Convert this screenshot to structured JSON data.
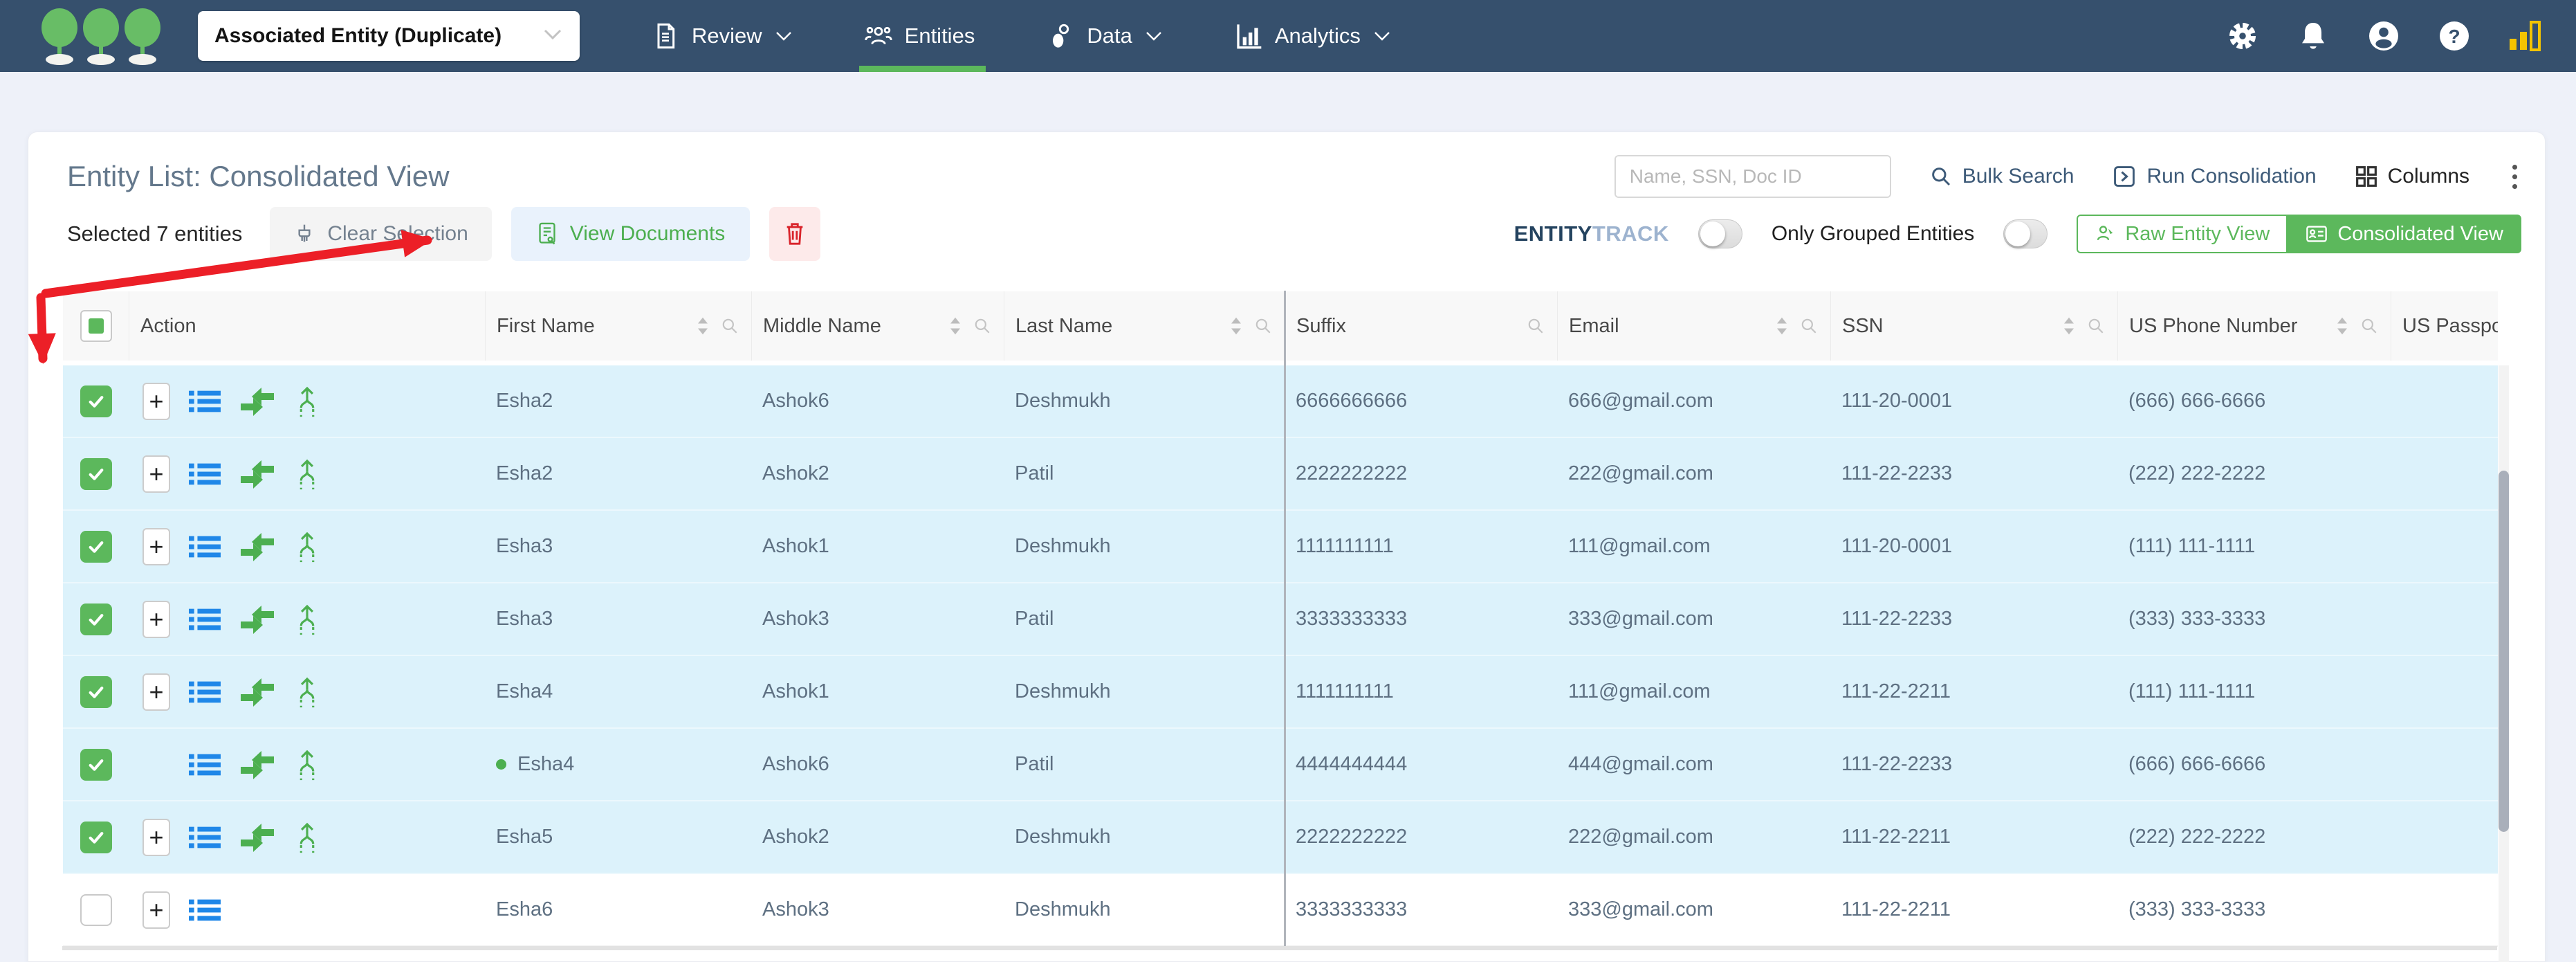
{
  "navbar": {
    "logo": "three-trees-logo",
    "workspace_dropdown": {
      "value": "Associated Entity (Duplicate)"
    },
    "items": [
      {
        "label": "Review",
        "icon": "document-icon",
        "caret": true,
        "active": false
      },
      {
        "label": "Entities",
        "icon": "people-icon",
        "caret": false,
        "active": true
      },
      {
        "label": "Data",
        "icon": "data-icon",
        "caret": true,
        "active": false
      },
      {
        "label": "Analytics",
        "icon": "bar-chart-icon",
        "caret": true,
        "active": false
      }
    ],
    "right_icons": [
      "settings-gear-icon",
      "notifications-bell-icon",
      "profile-icon",
      "help-icon",
      "signal-bars-icon"
    ]
  },
  "toolbar": {
    "title": "Entity List: Consolidated View",
    "search_placeholder": "Name, SSN, Doc ID",
    "bulk_search_label": "Bulk Search",
    "run_consolidation_label": "Run Consolidation",
    "columns_label": "Columns",
    "selection_summary": "Selected 7 entities",
    "clear_selection_label": "Clear Selection",
    "view_documents_label": "View Documents",
    "entitytrack_bold": "ENTITY",
    "entitytrack_light": "TRACK",
    "entitytrack_toggle_on": false,
    "only_grouped_label": "Only Grouped Entities",
    "only_grouped_toggle_on": false,
    "raw_view_label": "Raw Entity View",
    "consolidated_view_label": "Consolidated View",
    "active_view": "Consolidated View"
  },
  "table": {
    "columns": [
      {
        "label": "Action",
        "sortable": false,
        "searchable": false
      },
      {
        "label": "First Name",
        "sortable": true,
        "searchable": true
      },
      {
        "label": "Middle Name",
        "sortable": true,
        "searchable": true
      },
      {
        "label": "Last Name",
        "sortable": true,
        "searchable": true
      },
      {
        "label": "Suffix",
        "sortable": false,
        "searchable": true
      },
      {
        "label": "Email",
        "sortable": true,
        "searchable": true
      },
      {
        "label": "SSN",
        "sortable": true,
        "searchable": true
      },
      {
        "label": "US Phone Number",
        "sortable": true,
        "searchable": true
      },
      {
        "label": "US Passport N",
        "sortable": false,
        "searchable": false
      }
    ],
    "header_checkbox_state": "indeterminate",
    "rows": [
      {
        "checked": true,
        "has_expand": true,
        "has_list": true,
        "has_merge": true,
        "has_split": true,
        "group_dot": false,
        "first_name": "Esha2",
        "middle_name": "Ashok6",
        "last_name": "Deshmukh",
        "suffix": "6666666666",
        "email": "666@gmail.com",
        "ssn": "111-20-0001",
        "us_phone": "(666) 666-6666",
        "us_passport": ""
      },
      {
        "checked": true,
        "has_expand": true,
        "has_list": true,
        "has_merge": true,
        "has_split": true,
        "group_dot": false,
        "first_name": "Esha2",
        "middle_name": "Ashok2",
        "last_name": "Patil",
        "suffix": "2222222222",
        "email": "222@gmail.com",
        "ssn": "111-22-2233",
        "us_phone": "(222) 222-2222",
        "us_passport": ""
      },
      {
        "checked": true,
        "has_expand": true,
        "has_list": true,
        "has_merge": true,
        "has_split": true,
        "group_dot": false,
        "first_name": "Esha3",
        "middle_name": "Ashok1",
        "last_name": "Deshmukh",
        "suffix": "1111111111",
        "email": "111@gmail.com",
        "ssn": "111-20-0001",
        "us_phone": "(111) 111-1111",
        "us_passport": ""
      },
      {
        "checked": true,
        "has_expand": true,
        "has_list": true,
        "has_merge": true,
        "has_split": true,
        "group_dot": false,
        "first_name": "Esha3",
        "middle_name": "Ashok3",
        "last_name": "Patil",
        "suffix": "3333333333",
        "email": "333@gmail.com",
        "ssn": "111-22-2233",
        "us_phone": "(333) 333-3333",
        "us_passport": ""
      },
      {
        "checked": true,
        "has_expand": true,
        "has_list": true,
        "has_merge": true,
        "has_split": true,
        "group_dot": false,
        "first_name": "Esha4",
        "middle_name": "Ashok1",
        "last_name": "Deshmukh",
        "suffix": "1111111111",
        "email": "111@gmail.com",
        "ssn": "111-22-2211",
        "us_phone": "(111) 111-1111",
        "us_passport": ""
      },
      {
        "checked": true,
        "has_expand": false,
        "has_list": true,
        "has_merge": true,
        "has_split": true,
        "group_dot": true,
        "first_name": "Esha4",
        "middle_name": "Ashok6",
        "last_name": "Patil",
        "suffix": "4444444444",
        "email": "444@gmail.com",
        "ssn": "111-22-2233",
        "us_phone": "(666) 666-6666",
        "us_passport": ""
      },
      {
        "checked": true,
        "has_expand": true,
        "has_list": true,
        "has_merge": true,
        "has_split": true,
        "group_dot": false,
        "first_name": "Esha5",
        "middle_name": "Ashok2",
        "last_name": "Deshmukh",
        "suffix": "2222222222",
        "email": "222@gmail.com",
        "ssn": "111-22-2211",
        "us_phone": "(222) 222-2222",
        "us_passport": ""
      },
      {
        "checked": false,
        "has_expand": true,
        "has_list": true,
        "has_merge": false,
        "has_split": false,
        "group_dot": false,
        "first_name": "Esha6",
        "middle_name": "Ashok3",
        "last_name": "Deshmukh",
        "suffix": "3333333333",
        "email": "333@gmail.com",
        "ssn": "111-22-2211",
        "us_phone": "(333) 333-3333",
        "us_passport": ""
      }
    ]
  },
  "annotations": {
    "arrow_color": "#ec1f27",
    "arrows": [
      "arrow-to-view-documents",
      "arrow-to-first-row-checkbox"
    ]
  },
  "colors": {
    "navbar": "#36506d",
    "accent_green": "#5cb85c",
    "selected_row": "#dcf2fb",
    "danger_red": "#d9242b",
    "link_blue": "#1f87e8",
    "page_bg": "#eef1f9"
  }
}
